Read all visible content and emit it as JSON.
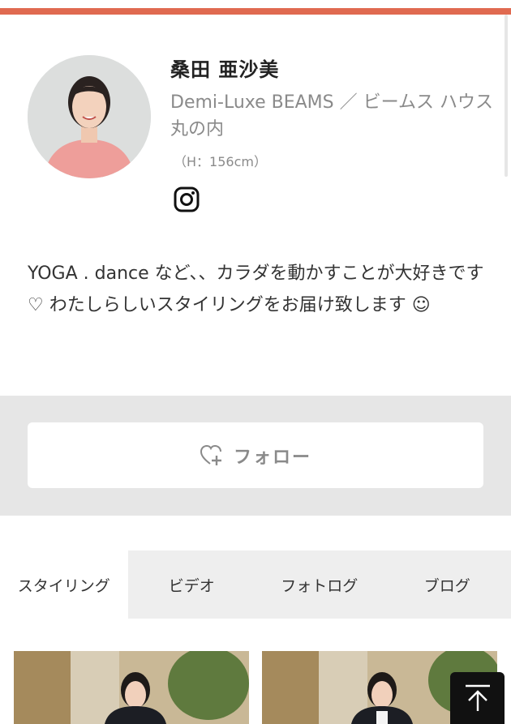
{
  "profile": {
    "name": "桑田 亜沙美",
    "shop": "Demi-Luxe BEAMS ／ ビームス ハウス 丸の内",
    "height": "（H：156cm）",
    "bio": "YOGA . dance など、、カラダを動かすことが大好きです ♡ わたしらしいスタイリングをお届け致します ☺"
  },
  "social": {
    "icon": "instagram-icon"
  },
  "follow": {
    "label": "フォロー",
    "icon": "heart-plus-icon"
  },
  "tabs": [
    {
      "label": "スタイリング",
      "active": true
    },
    {
      "label": "ビデオ",
      "active": false
    },
    {
      "label": "フォトログ",
      "active": false
    },
    {
      "label": "ブログ",
      "active": false
    }
  ],
  "scroll_top": {
    "icon": "arrow-up-icon"
  },
  "colors": {
    "accent": "#e06a50",
    "band": "#e6e6e6",
    "tab_bg": "#eeeeee"
  }
}
